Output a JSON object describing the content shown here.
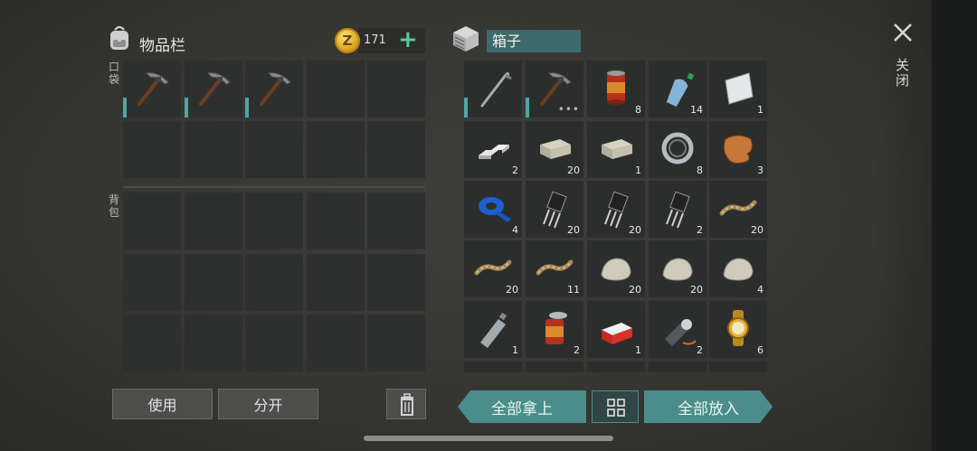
{
  "inventory": {
    "title": "物品栏",
    "coins": "171",
    "coin_symbol": "Z",
    "plus": "+",
    "pocket_label": "口袋",
    "backpack_label": "背包",
    "pocket_slots": [
      {
        "icon": "pickaxe-icon"
      },
      {
        "icon": "pickaxe-icon"
      },
      {
        "icon": "pickaxe-icon"
      },
      {
        "icon": "empty"
      },
      {
        "icon": "empty"
      }
    ]
  },
  "box": {
    "title": "箱子",
    "items": [
      {
        "icon": "crowbar-icon",
        "count": ""
      },
      {
        "icon": "pickaxe-icon",
        "count": "•••"
      },
      {
        "icon": "food-can-icon",
        "count": "8"
      },
      {
        "icon": "water-bottle-icon",
        "count": "14"
      },
      {
        "icon": "metal-sheet-icon",
        "count": "1"
      },
      {
        "icon": "aluminum-ingot-icon",
        "count": "2"
      },
      {
        "icon": "stone-brick-icon",
        "count": "20"
      },
      {
        "icon": "stone-brick-icon",
        "count": "1"
      },
      {
        "icon": "bearing-icon",
        "count": "8"
      },
      {
        "icon": "leather-icon",
        "count": "3"
      },
      {
        "icon": "blue-tape-icon",
        "count": "4"
      },
      {
        "icon": "transistor-icon",
        "count": "20"
      },
      {
        "icon": "transistor-icon",
        "count": "20"
      },
      {
        "icon": "transistor-icon",
        "count": "2"
      },
      {
        "icon": "rope-icon",
        "count": "20"
      },
      {
        "icon": "rope-icon",
        "count": "20"
      },
      {
        "icon": "rope-icon",
        "count": "11"
      },
      {
        "icon": "rock-icon",
        "count": "20"
      },
      {
        "icon": "rock-icon",
        "count": "20"
      },
      {
        "icon": "rock-icon",
        "count": "4"
      },
      {
        "icon": "plastic-bottle-icon",
        "count": "1"
      },
      {
        "icon": "open-can-icon",
        "count": "2"
      },
      {
        "icon": "cigarette-pack-icon",
        "count": "1"
      },
      {
        "icon": "flashlight-icon",
        "count": "2"
      },
      {
        "icon": "gold-watch-icon",
        "count": "6"
      }
    ]
  },
  "buttons": {
    "use": "使用",
    "split": "分开",
    "take_all": "全部拿上",
    "put_all": "全部放入",
    "close": "关闭"
  },
  "colors": {
    "accent": "#4b8d8a",
    "durability": "#4ea7a4",
    "coin": "#d6a21c"
  }
}
